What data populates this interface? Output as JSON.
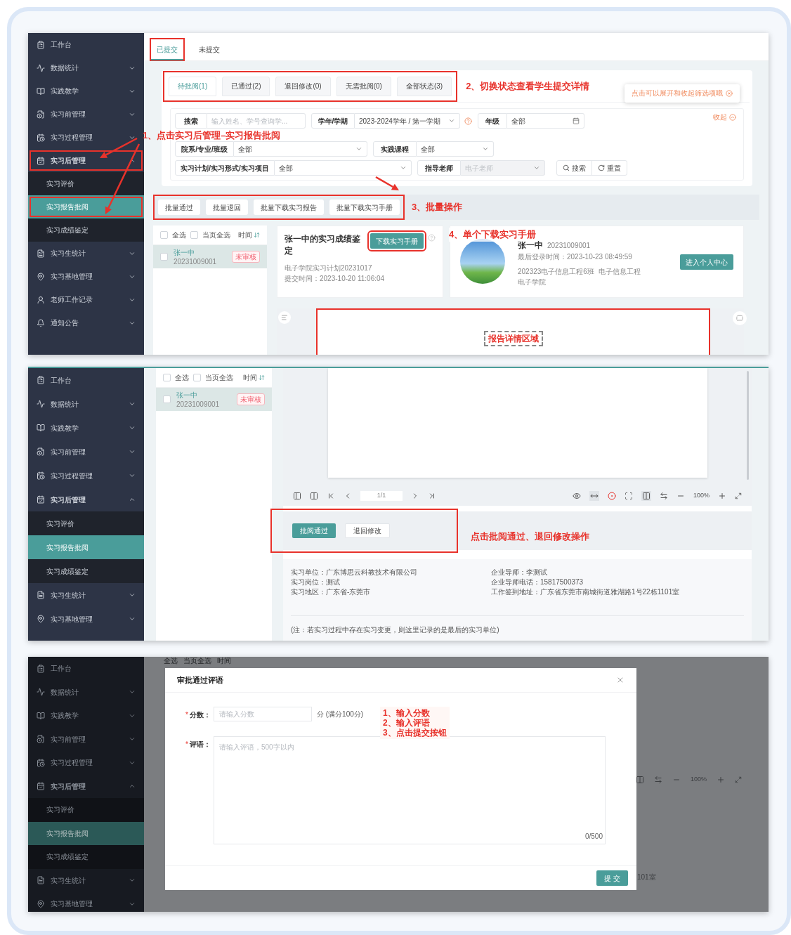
{
  "screen_1": {
    "sidebar": [
      {
        "label": "工作台",
        "kind": "link",
        "highlighted": false
      },
      {
        "label": "数据统计",
        "kind": "group",
        "expanded": false,
        "highlighted": false
      },
      {
        "label": "实践教学",
        "kind": "group",
        "expanded": false,
        "highlighted": false
      },
      {
        "label": "实习前管理",
        "kind": "group",
        "expanded": false,
        "highlighted": false
      },
      {
        "label": "实习过程管理",
        "kind": "group",
        "expanded": false,
        "highlighted": false
      },
      {
        "label": "实习后管理",
        "kind": "group",
        "expanded": true,
        "highlighted": true,
        "children": [
          {
            "label": "实习评价",
            "selected": false,
            "highlighted": false
          },
          {
            "label": "实习报告批阅",
            "selected": true,
            "highlighted": true
          },
          {
            "label": "实习成绩鉴定",
            "selected": false,
            "highlighted": false
          }
        ]
      },
      {
        "label": "实习生统计",
        "kind": "group",
        "expanded": false,
        "highlighted": false
      },
      {
        "label": "实习基地管理",
        "kind": "group",
        "expanded": false,
        "highlighted": false
      },
      {
        "label": "老师工作记录",
        "kind": "group",
        "expanded": false,
        "highlighted": false
      },
      {
        "label": "通知公告",
        "kind": "group",
        "expanded": false,
        "highlighted": false
      }
    ],
    "top_tabs": [
      {
        "label": "已提交",
        "selected": true,
        "highlighted": true
      },
      {
        "label": "未提交",
        "selected": false,
        "highlighted": false
      }
    ],
    "status_tabs": [
      {
        "label": "待批阅(1)",
        "selected": true
      },
      {
        "label": "已通过(2)",
        "selected": false
      },
      {
        "label": "退回修改(0)",
        "selected": false
      },
      {
        "label": "无需批阅(0)",
        "selected": false
      },
      {
        "label": "全部状态(3)",
        "selected": false
      }
    ],
    "tip": "点击可以展开和收起筛选项哦",
    "collapse": "收起",
    "filters": [
      [
        {
          "label": "搜索",
          "kind": "input",
          "placeholder": "输入姓名、学号查询学...",
          "help": false,
          "disabled": false
        },
        {
          "label": "学年/学期",
          "kind": "select",
          "value": "2023-2024学年 / 第一学期",
          "help": true,
          "disabled": false
        },
        {
          "label": "年级",
          "kind": "date",
          "value": "全部",
          "help": false,
          "disabled": false
        }
      ],
      [
        {
          "label": "院系/专业/班级",
          "kind": "select",
          "value": "全部",
          "help": false,
          "disabled": false
        },
        {
          "label": "实践课程",
          "kind": "select",
          "value": "全部",
          "help": false,
          "disabled": false
        }
      ],
      [
        {
          "label": "实习计划/实习形式/实习项目",
          "kind": "select",
          "value": "全部",
          "help": false,
          "disabled": false
        },
        {
          "label": "指导老师",
          "kind": "select",
          "value": "电子老师",
          "help": false,
          "disabled": true
        }
      ]
    ],
    "search_button": "搜索",
    "reset_button": "重置",
    "batch_buttons": [
      "批量通过",
      "批量退回",
      "批量下载实习报告",
      "批量下载实习手册"
    ],
    "list": {
      "select_all": {
        "label": "全选",
        "checked": false
      },
      "select_page": {
        "label": "当页全选",
        "checked": false
      },
      "sort_label": "时间",
      "rows": [
        {
          "name": "张一中",
          "id": "20231009001",
          "status": "未审核",
          "checked": false,
          "selected": true
        }
      ]
    },
    "report_card": {
      "title": "张一中的实习成绩鉴定",
      "button": "下载实习手册",
      "plan": "电子学院实习计划20231017",
      "submitted": "提交时间：2023-10-20 11:06:04"
    },
    "profile": {
      "name": "张一中",
      "id": "20231009001",
      "last_login": "最后登录时间：2023-10-23 08:49:59",
      "class": "202323电子信息工程6班",
      "major": "电子信息工程",
      "college": "电子学院",
      "button": "进入个人中心"
    },
    "report_area": {
      "label": "报告详情区域"
    },
    "annotations": [
      "1、点击实习后管理–实习报告批阅",
      "2、切换状态查看学生提交详情",
      "3、批量操作",
      "4、单个下载实习手册"
    ]
  },
  "screen_2": {
    "sidebar": [
      {
        "label": "工作台",
        "kind": "link"
      },
      {
        "label": "数据统计",
        "kind": "group",
        "expanded": false
      },
      {
        "label": "实践教学",
        "kind": "group",
        "expanded": false
      },
      {
        "label": "实习前管理",
        "kind": "group",
        "expanded": false
      },
      {
        "label": "实习过程管理",
        "kind": "group",
        "expanded": false
      },
      {
        "label": "实习后管理",
        "kind": "group",
        "expanded": true,
        "children": [
          {
            "label": "实习评价",
            "selected": false
          },
          {
            "label": "实习报告批阅",
            "selected": true
          },
          {
            "label": "实习成绩鉴定",
            "selected": false
          }
        ]
      },
      {
        "label": "实习生统计",
        "kind": "group",
        "expanded": false
      },
      {
        "label": "实习基地管理",
        "kind": "group",
        "expanded": false
      }
    ],
    "list": {
      "select_all": {
        "label": "全选",
        "checked": false
      },
      "select_page": {
        "label": "当页全选",
        "checked": false
      },
      "sort_label": "时间",
      "rows": [
        {
          "name": "张一中",
          "id": "20231009001",
          "status": "未审核",
          "checked": false,
          "selected": true
        }
      ]
    },
    "viewer": {
      "page": "1/1",
      "zoom": "100%"
    },
    "actions": [
      {
        "label": "批阅通过",
        "kind": "primary"
      },
      {
        "label": "退回修改",
        "kind": "default"
      }
    ],
    "annotation": "点击批阅通过、退回修改操作",
    "details_left": [
      "实习单位：广东博思云科教技术有限公司",
      "实习岗位：测试",
      "实习地区：广东省-东莞市"
    ],
    "details_right": [
      "企业导师：李测试",
      "企业导师电话：15817500373",
      "工作签到地址：广东省东莞市南城街道雅湖路1号22栋1101室"
    ],
    "note": "(注：若实习过程中存在实习变更，则这里记录的是最后的实习单位)"
  },
  "screen_3": {
    "sidebar": [
      {
        "label": "工作台",
        "kind": "link"
      },
      {
        "label": "数据统计",
        "kind": "group",
        "expanded": false
      },
      {
        "label": "实践教学",
        "kind": "group",
        "expanded": false
      },
      {
        "label": "实习前管理",
        "kind": "group",
        "expanded": false
      },
      {
        "label": "实习过程管理",
        "kind": "group",
        "expanded": false
      },
      {
        "label": "实习后管理",
        "kind": "group",
        "expanded": true,
        "children": [
          {
            "label": "实习评价",
            "selected": false
          },
          {
            "label": "实习报告批阅",
            "selected": true
          },
          {
            "label": "实习成绩鉴定",
            "selected": false
          }
        ]
      },
      {
        "label": "实习生统计",
        "kind": "group",
        "expanded": false
      },
      {
        "label": "实习基地管理",
        "kind": "group",
        "expanded": false
      }
    ],
    "background": {
      "list_header": [
        "全选",
        "当页全选",
        "时间"
      ],
      "zoom": "100%",
      "address_fragment": "101室"
    },
    "dialog": {
      "title": "审批通过评语",
      "fields": [
        {
          "label": "分数：",
          "kind": "input",
          "required_mark": "*",
          "placeholder": "请输入分数",
          "suffix": "分 (满分100分)"
        },
        {
          "label": "评语：",
          "kind": "textarea",
          "required_mark": "*",
          "placeholder": "请输入评语，500字以内",
          "count": "0/500"
        }
      ],
      "submit": "提 交"
    },
    "annotations": [
      "1、输入分数",
      "2、输入评语",
      "3、点击提交按钮"
    ]
  }
}
